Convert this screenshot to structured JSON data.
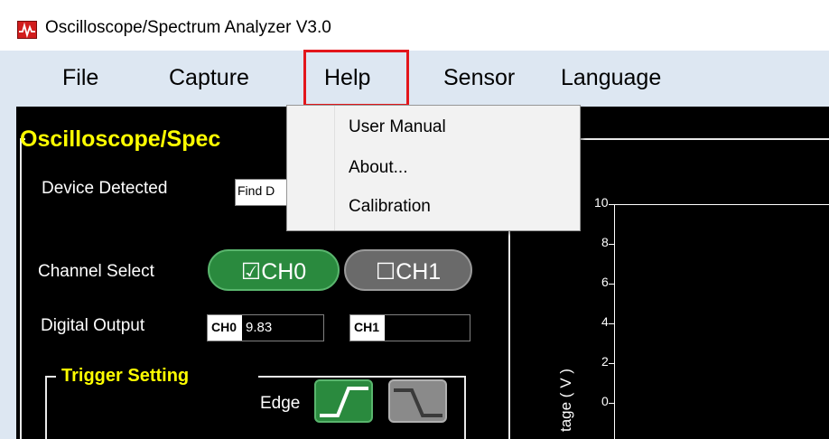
{
  "window": {
    "title": "Oscilloscope/Spectrum Analyzer V3.0"
  },
  "menubar": {
    "items": [
      {
        "label": "File"
      },
      {
        "label": "Capture"
      },
      {
        "label": "Help"
      },
      {
        "label": "Sensor"
      },
      {
        "label": "Language"
      }
    ],
    "highlight_color": "#e3161b"
  },
  "help_menu": {
    "items": [
      {
        "label": "User Manual"
      },
      {
        "label": "About..."
      },
      {
        "label": "Calibration"
      }
    ]
  },
  "panel": {
    "title": "Oscilloscope/Spec",
    "device_detected_label": "Device Detected",
    "device_value": "Find D",
    "channel_select_label": "Channel Select",
    "ch0_label": "☑CH0",
    "ch1_label": "☐CH1",
    "digital_output_label": "Digital Output",
    "ch0_output_tag": "CH0",
    "ch0_output_value": "9.83",
    "ch1_output_tag": "CH1",
    "ch1_output_value": "",
    "trigger": {
      "title": "Trigger Setting",
      "edge_label": "Edge",
      "rising_icon": "rising-edge-icon",
      "falling_icon": "falling-edge-icon"
    }
  },
  "plot": {
    "y_axis_label": "tage ( V )",
    "y_ticks": [
      "10",
      "8",
      "6",
      "4",
      "2",
      "0"
    ]
  },
  "colors": {
    "panel_bg": "#000000",
    "accent_yellow": "#ffff00",
    "ch0_green": "#2a8a3e",
    "ch1_gray": "#6a6a6a",
    "menubar_bg": "#dde7f2"
  }
}
